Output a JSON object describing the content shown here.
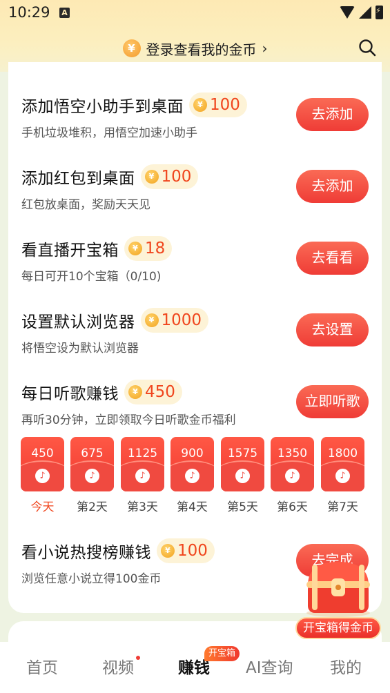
{
  "status_bar": {
    "time": "10:29",
    "badge": "A"
  },
  "header": {
    "coin_symbol": "¥",
    "login_text": "登录查看我的金币",
    "chevron": "›"
  },
  "tasks": [
    {
      "title": "添加悟空小助手到桌面",
      "reward": "100",
      "desc": "手机垃圾堆积，用悟空加速小助手",
      "button": "去添加"
    },
    {
      "title": "添加红包到桌面",
      "reward": "100",
      "desc": "红包放桌面，奖励天天见",
      "button": "去添加"
    },
    {
      "title": "看直播开宝箱",
      "reward": "18",
      "desc": "每日可开10个宝箱（0/10)",
      "button": "去看看"
    },
    {
      "title": "设置默认浏览器",
      "reward": "1000",
      "desc": "将悟空设为默认浏览器",
      "button": "去设置"
    },
    {
      "title": "每日听歌赚钱",
      "reward": "450",
      "desc": "再听30分钟，立即领取今日听歌金币福利",
      "button": "立即听歌"
    },
    {
      "title": "看小说热搜榜赚钱",
      "reward": "100",
      "desc": "浏览任意小说立得100金币",
      "button": "去完成"
    }
  ],
  "music_days": [
    {
      "value": "450",
      "label": "今天"
    },
    {
      "value": "675",
      "label": "第2天"
    },
    {
      "value": "1125",
      "label": "第3天"
    },
    {
      "value": "900",
      "label": "第4天"
    },
    {
      "value": "1575",
      "label": "第5天"
    },
    {
      "value": "1350",
      "label": "第6天"
    },
    {
      "value": "1800",
      "label": "第7天"
    }
  ],
  "treasure": {
    "label": "开宝箱得金币"
  },
  "nav": {
    "items": [
      "首页",
      "视频",
      "赚钱",
      "AI查询",
      "我的"
    ],
    "badge": "开宝箱"
  },
  "colors": {
    "accent": "#ef3c36",
    "reward": "#f0461e",
    "header_bg": "#fde9b4"
  }
}
